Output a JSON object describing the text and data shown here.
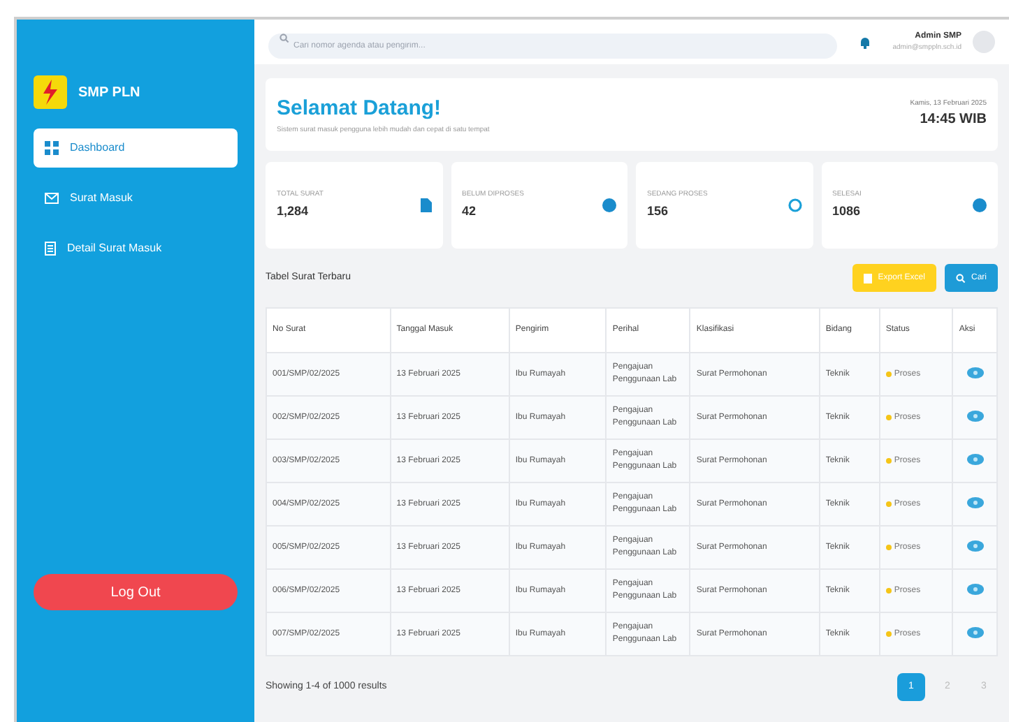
{
  "sidebar": {
    "brand": "SMP PLN",
    "items": [
      {
        "label": "Dashboard",
        "kind": "grid",
        "selected": true
      },
      {
        "label": "Surat Masuk",
        "kind": "mail",
        "selected": false
      },
      {
        "label": "Detail Surat Masuk",
        "kind": "doc",
        "selected": false
      }
    ],
    "logout": "Log Out"
  },
  "topbar": {
    "search_placeholder": "Cari nomor agenda atau pengirim...",
    "user": "Admin SMP",
    "user_email": "admin@smppln.sch.id"
  },
  "welcome": {
    "title": "Selamat Datang!",
    "subtitle": "Sistem surat masuk pengguna lebih mudah dan cepat di satu tempat",
    "date": "Kamis, 13 Februari 2025",
    "time": "14:45 WIB"
  },
  "stats": [
    {
      "label": "TOTAL SURAT",
      "value": "1,284",
      "kind": "file"
    },
    {
      "label": "BELUM DIPROSES",
      "value": "42",
      "kind": "dot"
    },
    {
      "label": "SEDANG PROSES",
      "value": "156",
      "kind": "ring"
    },
    {
      "label": "SELESAI",
      "value": "1086",
      "kind": "dot"
    }
  ],
  "table": {
    "title": "Tabel Surat Terbaru",
    "export_button": "Export Excel",
    "search_button": "Cari",
    "columns": [
      "No Surat",
      "Tanggal Masuk",
      "Pengirim",
      "Perihal",
      "Klasifikasi",
      "Bidang",
      "Status",
      "Aksi"
    ],
    "rows": [
      {
        "cells": [
          "001/SMP/02/2025",
          "13 Februari 2025",
          "Ibu Rumayah",
          "Pengajuan Penggunaan Lab",
          "Surat Permohonan",
          "Teknik"
        ],
        "status": "Proses"
      },
      {
        "cells": [
          "002/SMP/02/2025",
          "13 Februari 2025",
          "Ibu Rumayah",
          "Pengajuan Penggunaan Lab",
          "Surat Permohonan",
          "Teknik"
        ],
        "status": "Proses"
      },
      {
        "cells": [
          "003/SMP/02/2025",
          "13 Februari 2025",
          "Ibu Rumayah",
          "Pengajuan Penggunaan Lab",
          "Surat Permohonan",
          "Teknik"
        ],
        "status": "Proses"
      },
      {
        "cells": [
          "004/SMP/02/2025",
          "13 Februari 2025",
          "Ibu Rumayah",
          "Pengajuan Penggunaan Lab",
          "Surat Permohonan",
          "Teknik"
        ],
        "status": "Proses"
      },
      {
        "cells": [
          "005/SMP/02/2025",
          "13 Februari 2025",
          "Ibu Rumayah",
          "Pengajuan Penggunaan Lab",
          "Surat Permohonan",
          "Teknik"
        ],
        "status": "Proses"
      },
      {
        "cells": [
          "006/SMP/02/2025",
          "13 Februari 2025",
          "Ibu Rumayah",
          "Pengajuan Penggunaan Lab",
          "Surat Permohonan",
          "Teknik"
        ],
        "status": "Proses"
      },
      {
        "cells": [
          "007/SMP/02/2025",
          "13 Februari 2025",
          "Ibu Rumayah",
          "Pengajuan Penggunaan Lab",
          "Surat Permohonan",
          "Teknik"
        ],
        "status": "Proses"
      }
    ]
  },
  "footer": {
    "summary": "Showing 1-4 of 1000 results",
    "pages": [
      {
        "label": "1",
        "selected": true
      },
      {
        "label": "2",
        "selected": false
      },
      {
        "label": "3",
        "selected": false
      }
    ]
  }
}
